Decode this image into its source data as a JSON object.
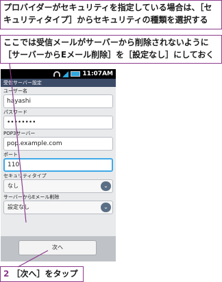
{
  "callouts": {
    "top_text": "プロバイダーがセキュリティを指定している場合は、［セキュリティタイプ］からセキュリティの種類を選択する",
    "middle_text": "ここでは受信メールがサーバーから削除されないように［サーバーからEメール削除］を［設定なし］にしておく",
    "step_number": "2",
    "step_text": "［次へ］をタップ"
  },
  "status_bar": {
    "time": "11:07AM",
    "icons": [
      "wifi-icon",
      "signal-icon",
      "battery-icon"
    ]
  },
  "screen": {
    "title": "受信サーバー設定"
  },
  "form": {
    "username_label": "ユーザー名",
    "username_value": "hayashi",
    "password_label": "パスワード",
    "password_value": "••••••••",
    "pop3_label": "POP3サーバー",
    "pop3_value": "pop.example.com",
    "port_label": "ポート",
    "port_value": "110",
    "security_label": "セキュリティタイプ",
    "security_value": "なし",
    "delete_label": "サーバーからEメール削除",
    "delete_value": "設定なし"
  },
  "buttons": {
    "next_label": "次へ"
  },
  "colors": {
    "accent": "#3fa9e8",
    "callout_border": "#8b3a8b",
    "titlebar": "#3b4a66"
  }
}
